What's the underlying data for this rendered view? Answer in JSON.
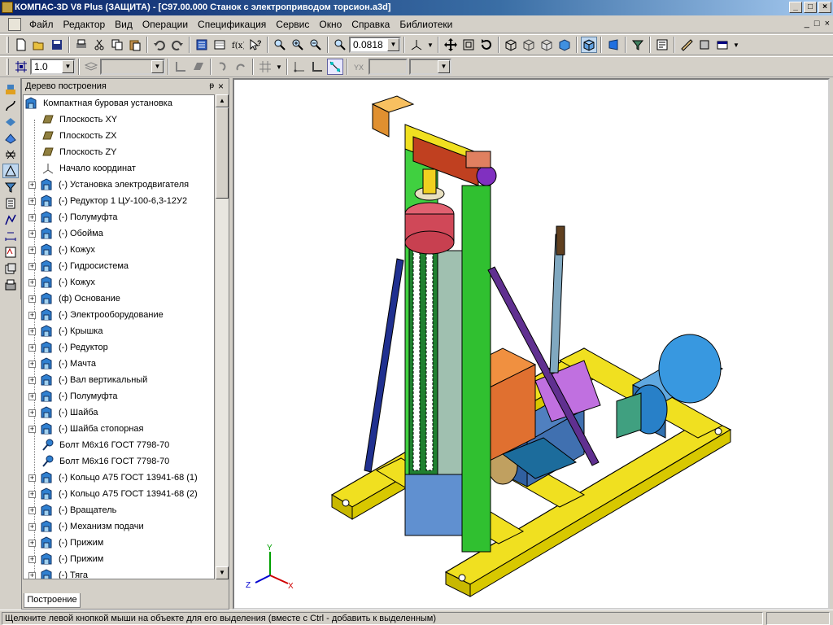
{
  "window": {
    "title": "КОМПАС-3D V8 Plus (ЗАЩИТА) - [C97.00.000 Станок с электроприводом торсион.a3d]",
    "minimize": "_",
    "maximize": "□",
    "close": "×"
  },
  "menu": [
    "Файл",
    "Редактор",
    "Вид",
    "Операции",
    "Спецификация",
    "Сервис",
    "Окно",
    "Справка",
    "Библиотеки"
  ],
  "mdi_controls": [
    "_",
    "□",
    "×"
  ],
  "toolbar1": {
    "zoom_value": "0.0818"
  },
  "toolbar2": {
    "step_value": "1.0"
  },
  "panel": {
    "title": "Дерево построения",
    "pin": "ᵽ",
    "close": "×",
    "tab": "Построение"
  },
  "tree": {
    "root": "Компактная буровая установка",
    "items": [
      {
        "label": "Плоскость XY",
        "type": "plane"
      },
      {
        "label": "Плоскость ZX",
        "type": "plane"
      },
      {
        "label": "Плоскость ZY",
        "type": "plane"
      },
      {
        "label": "Начало координат",
        "type": "origin"
      },
      {
        "label": "(-) Установка электродвигателя",
        "type": "part"
      },
      {
        "label": "(-) Редуктор 1 ЦУ-100-6,3-12У2",
        "type": "part"
      },
      {
        "label": "(-) Полумуфта",
        "type": "part"
      },
      {
        "label": "(-) Обойма",
        "type": "part"
      },
      {
        "label": "(-) Кожух",
        "type": "part"
      },
      {
        "label": "(-) Гидросистема",
        "type": "part"
      },
      {
        "label": "(-) Кожух",
        "type": "part"
      },
      {
        "label": "(ф) Основание",
        "type": "part"
      },
      {
        "label": "(-) Электрооборудование",
        "type": "part"
      },
      {
        "label": "(-) Крышка",
        "type": "part"
      },
      {
        "label": "(-) Редуктор",
        "type": "part"
      },
      {
        "label": "(-) Мачта",
        "type": "part"
      },
      {
        "label": "(-) Вал  вертикальный",
        "type": "part"
      },
      {
        "label": "(-) Полумуфта",
        "type": "part"
      },
      {
        "label": "(-) Шайба",
        "type": "part"
      },
      {
        "label": "(-) Шайба стопорная",
        "type": "part"
      },
      {
        "label": "Болт М6х16 ГОСТ 7798-70",
        "type": "bolt"
      },
      {
        "label": "Болт М6х16 ГОСТ 7798-70",
        "type": "bolt"
      },
      {
        "label": "(-) Кольцо А75 ГОСТ 13941-68 (1)",
        "type": "part"
      },
      {
        "label": "(-) Кольцо А75 ГОСТ 13941-68 (2)",
        "type": "part"
      },
      {
        "label": "(-) Вращатель",
        "type": "part"
      },
      {
        "label": "(-) Механизм подачи",
        "type": "part"
      },
      {
        "label": "(-) Прижим",
        "type": "part"
      },
      {
        "label": "(-) Прижим",
        "type": "part"
      },
      {
        "label": "(-) Тяга",
        "type": "part"
      }
    ]
  },
  "axes": {
    "x": "X",
    "y": "Y",
    "z": "Z"
  },
  "status": {
    "hint": "Щелкните левой кнопкой мыши на объекте для его выделения (вместе с Ctrl - добавить к выделенным)"
  }
}
